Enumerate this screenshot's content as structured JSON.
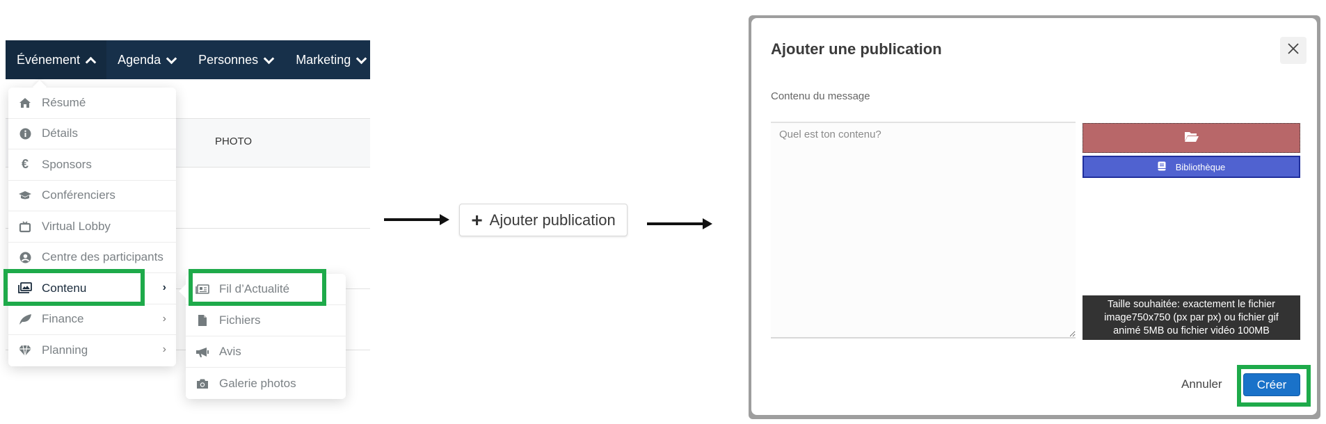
{
  "navbar": {
    "items": [
      {
        "label": "Événement",
        "chevron": "chevron-up-icon",
        "active": true
      },
      {
        "label": "Agenda",
        "chevron": "chevron-down-icon",
        "active": false
      },
      {
        "label": "Personnes",
        "chevron": "chevron-down-icon",
        "active": false
      },
      {
        "label": "Marketing",
        "chevron": "chevron-down-icon",
        "active": false
      }
    ]
  },
  "table": {
    "header": {
      "photo": "PHOTO"
    }
  },
  "event_menu": {
    "items": [
      {
        "label": "Résumé",
        "icon": "home-icon"
      },
      {
        "label": "Détails",
        "icon": "info-circle-icon"
      },
      {
        "label": "Sponsors",
        "icon": "euro-icon"
      },
      {
        "label": "Conférenciers",
        "icon": "graduation-cap-icon"
      },
      {
        "label": "Virtual Lobby",
        "icon": "tv-icon"
      },
      {
        "label": "Centre des participants",
        "icon": "user-circle-icon"
      },
      {
        "label": "Contenu",
        "icon": "images-icon",
        "submenu": true,
        "selected": true
      },
      {
        "label": "Finance",
        "icon": "leaf-icon",
        "submenu": true
      },
      {
        "label": "Planning",
        "icon": "gem-icon",
        "submenu": true
      }
    ]
  },
  "content_submenu": {
    "items": [
      {
        "label": "Fil d’Actualité",
        "icon": "newspaper-icon",
        "highlighted": true
      },
      {
        "label": "Fichiers",
        "icon": "file-icon"
      },
      {
        "label": "Avis",
        "icon": "bullhorn-icon"
      },
      {
        "label": "Galerie photos",
        "icon": "camera-icon"
      }
    ]
  },
  "add_button": {
    "label": "Ajouter publication",
    "icon": "plus-icon"
  },
  "dialog": {
    "title": "Ajouter une publication",
    "close_icon": "close-icon",
    "content_label": "Contenu du message",
    "textarea": {
      "value": "",
      "placeholder": "Quel est ton contenu?"
    },
    "upload_icon": "folder-open-icon",
    "library_label": "Bibliothèque",
    "library_icon": "book-icon",
    "size_tip": [
      "Taille souhaitée: exactement le fichier",
      "image750x750 (px par px) ou fichier gif",
      "animé 5MB ou fichier vidéo 100MB"
    ],
    "cancel_label": "Annuler",
    "create_label": "Créer"
  },
  "colors": {
    "navbar": "#17304a",
    "highlight": "#1eaa4a",
    "upload": "#b86769",
    "library": "#5062d0",
    "create": "#1a72c9",
    "tooltip": "#333333"
  }
}
